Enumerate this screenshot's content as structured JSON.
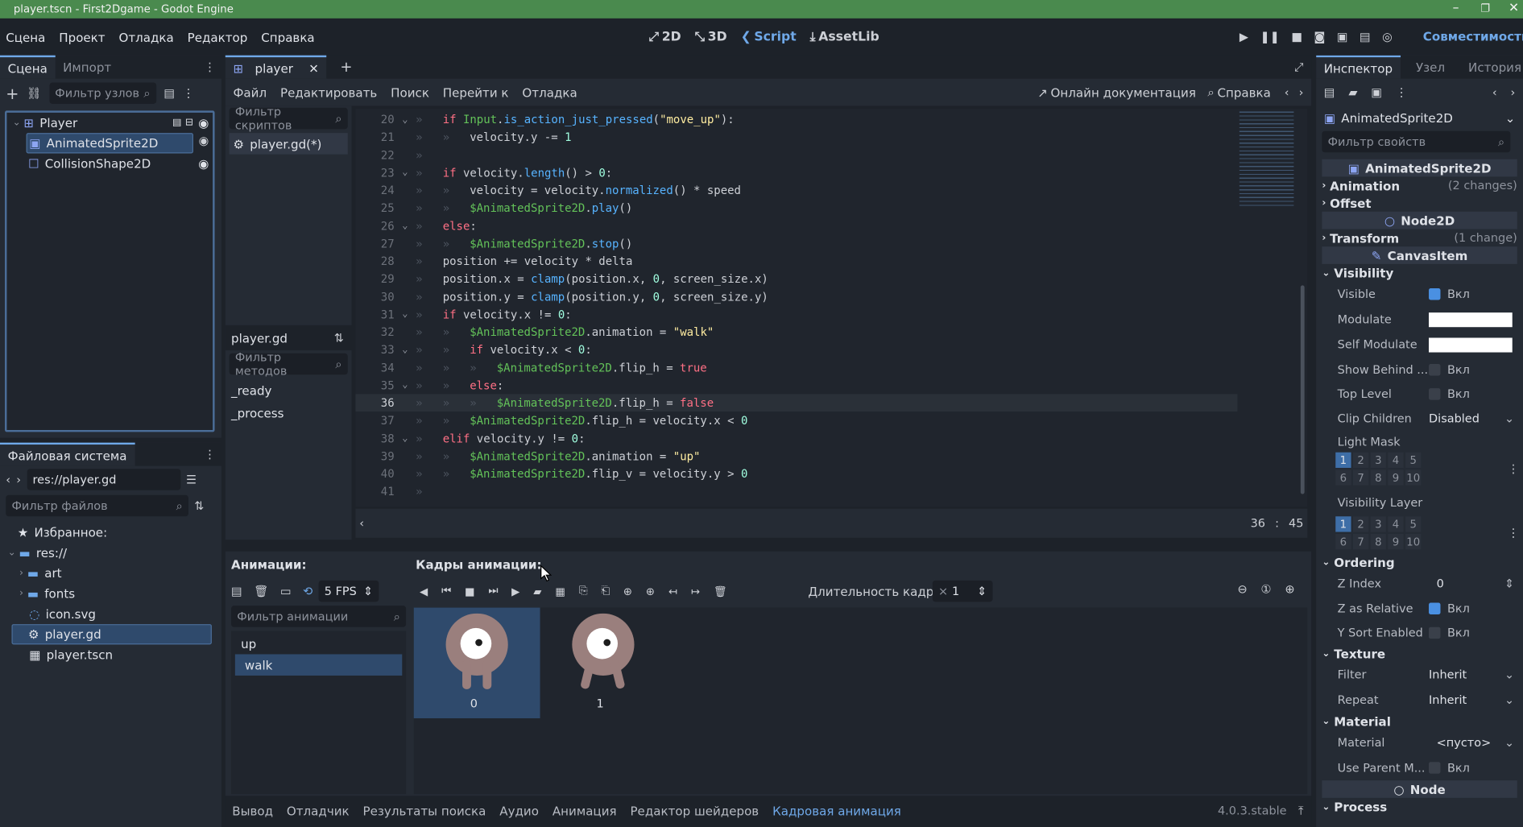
{
  "window": {
    "title": "player.tscn - First2Dgame - Godot Engine"
  },
  "menu": {
    "items": [
      "Сцена",
      "Проект",
      "Отладка",
      "Редактор",
      "Справка"
    ]
  },
  "workspaces": {
    "d2": "2D",
    "d3": "3D",
    "script": "Script",
    "assetlib": "AssetLib"
  },
  "renderer": "Совместимость",
  "scene_dock": {
    "tabs": [
      "Сцена",
      "Импорт"
    ],
    "filter_placeholder": "Фильтр узлов",
    "nodes": [
      "Player",
      "AnimatedSprite2D",
      "CollisionShape2D"
    ]
  },
  "fs_dock": {
    "title": "Файловая система",
    "path": "res://player.gd",
    "filter_placeholder": "Фильтр файлов",
    "favorites": "Избранное:",
    "root": "res://",
    "folders": [
      "art",
      "fonts"
    ],
    "files": [
      "icon.svg",
      "player.gd",
      "player.tscn"
    ]
  },
  "editor_tabs": {
    "current": "player"
  },
  "script_menu": {
    "items": [
      "Файл",
      "Редактировать",
      "Поиск",
      "Перейти к",
      "Отладка"
    ],
    "online_docs": "Онлайн документация",
    "help": "Справка"
  },
  "script_list": {
    "filter_placeholder": "Фильтр скриптов",
    "current": "player.gd(*)",
    "name": "player.gd",
    "methods_placeholder": "Фильтр методов",
    "methods": [
      "_ready",
      "_process"
    ]
  },
  "code": {
    "lines": [
      {
        "n": "20",
        "t": [
          [
            "kw",
            "if "
          ],
          [
            "nd",
            "Input"
          ],
          [
            "pl",
            "."
          ],
          [
            "fn",
            "is_action_just_pressed"
          ],
          [
            "pl",
            "("
          ],
          [
            "st",
            "\"move_up\""
          ],
          [
            "pl",
            "):"
          ]
        ],
        "ind": 1,
        "fold": true
      },
      {
        "n": "21",
        "t": [
          [
            "pl",
            "velocity.y "
          ],
          [
            "pl",
            "-= "
          ],
          [
            "nu",
            "1"
          ]
        ],
        "ind": 2
      },
      {
        "n": "22",
        "t": [],
        "ind": 1
      },
      {
        "n": "23",
        "t": [
          [
            "kw",
            "if "
          ],
          [
            "pl",
            "velocity."
          ],
          [
            "fn",
            "length"
          ],
          [
            "pl",
            "() > "
          ],
          [
            "nu",
            "0"
          ],
          [
            "pl",
            ":"
          ]
        ],
        "ind": 1,
        "fold": true
      },
      {
        "n": "24",
        "t": [
          [
            "pl",
            "velocity = velocity."
          ],
          [
            "fn",
            "normalized"
          ],
          [
            "pl",
            "() * speed"
          ]
        ],
        "ind": 2
      },
      {
        "n": "25",
        "t": [
          [
            "nd",
            "$AnimatedSprite2D"
          ],
          [
            "pl",
            "."
          ],
          [
            "fn",
            "play"
          ],
          [
            "pl",
            "()"
          ]
        ],
        "ind": 2
      },
      {
        "n": "26",
        "t": [
          [
            "kw",
            "else"
          ],
          [
            "pl",
            ":"
          ]
        ],
        "ind": 1,
        "fold": true
      },
      {
        "n": "27",
        "t": [
          [
            "nd",
            "$AnimatedSprite2D"
          ],
          [
            "pl",
            "."
          ],
          [
            "fn",
            "stop"
          ],
          [
            "pl",
            "()"
          ]
        ],
        "ind": 2
      },
      {
        "n": "28",
        "t": [
          [
            "pl",
            "position += velocity * delta"
          ]
        ],
        "ind": 1
      },
      {
        "n": "29",
        "t": [
          [
            "pl",
            "position.x = "
          ],
          [
            "fn",
            "clamp"
          ],
          [
            "pl",
            "(position.x, "
          ],
          [
            "nu",
            "0"
          ],
          [
            "pl",
            ", screen_size.x)"
          ]
        ],
        "ind": 1
      },
      {
        "n": "30",
        "t": [
          [
            "pl",
            "position.y = "
          ],
          [
            "fn",
            "clamp"
          ],
          [
            "pl",
            "(position.y, "
          ],
          [
            "nu",
            "0"
          ],
          [
            "pl",
            ", screen_size.y)"
          ]
        ],
        "ind": 1
      },
      {
        "n": "31",
        "t": [
          [
            "kw",
            "if "
          ],
          [
            "pl",
            "velocity.x != "
          ],
          [
            "nu",
            "0"
          ],
          [
            "pl",
            ":"
          ]
        ],
        "ind": 1,
        "fold": true
      },
      {
        "n": "32",
        "t": [
          [
            "nd",
            "$AnimatedSprite2D"
          ],
          [
            "pl",
            ".animation = "
          ],
          [
            "st",
            "\"walk\""
          ]
        ],
        "ind": 2
      },
      {
        "n": "33",
        "t": [
          [
            "kw",
            "if "
          ],
          [
            "pl",
            "velocity.x < "
          ],
          [
            "nu",
            "0"
          ],
          [
            "pl",
            ":"
          ]
        ],
        "ind": 2,
        "fold": true
      },
      {
        "n": "34",
        "t": [
          [
            "nd",
            "$AnimatedSprite2D"
          ],
          [
            "pl",
            ".flip_h = "
          ],
          [
            "bt",
            "true"
          ]
        ],
        "ind": 3
      },
      {
        "n": "35",
        "t": [
          [
            "kw",
            "else"
          ],
          [
            "pl",
            ":"
          ]
        ],
        "ind": 2,
        "fold": true
      },
      {
        "n": "36",
        "t": [
          [
            "nd",
            "$AnimatedSprite2D"
          ],
          [
            "pl",
            ".flip_h = "
          ],
          [
            "bt",
            "false"
          ]
        ],
        "ind": 3,
        "current": true
      },
      {
        "n": "37",
        "t": [
          [
            "nd",
            "$AnimatedSprite2D"
          ],
          [
            "pl",
            ".flip_h = velocity.x < "
          ],
          [
            "nu",
            "0"
          ]
        ],
        "ind": 2
      },
      {
        "n": "38",
        "t": [
          [
            "kw",
            "elif "
          ],
          [
            "pl",
            "velocity.y != "
          ],
          [
            "nu",
            "0"
          ],
          [
            "pl",
            ":"
          ]
        ],
        "ind": 1,
        "fold": true
      },
      {
        "n": "39",
        "t": [
          [
            "nd",
            "$AnimatedSprite2D"
          ],
          [
            "pl",
            ".animation = "
          ],
          [
            "st",
            "\"up\""
          ]
        ],
        "ind": 2
      },
      {
        "n": "40",
        "t": [
          [
            "nd",
            "$AnimatedSprite2D"
          ],
          [
            "pl",
            ".flip_v = velocity.y > "
          ],
          [
            "nu",
            "0"
          ]
        ],
        "ind": 2
      },
      {
        "n": "41",
        "t": [],
        "ind": 1
      }
    ],
    "cursor_line": "36",
    "cursor_col": "45",
    "sep": ":"
  },
  "anim_panel": {
    "animations_label": "Анимации:",
    "frames_label": "Кадры анимации:",
    "fps": "5 FPS",
    "filter_placeholder": "Фильтр анимации",
    "anims": [
      "up",
      "walk"
    ],
    "selected": "walk",
    "duration_label": "Длительность кадра:",
    "duration_value": "1",
    "frames": [
      "0",
      "1"
    ]
  },
  "bottom_tabs": [
    "Вывод",
    "Отладчик",
    "Результаты поиска",
    "Аудио",
    "Анимация",
    "Редактор шейдеров",
    "Кадровая анимация"
  ],
  "version": "4.0.3.stable",
  "inspector": {
    "tabs": [
      "Инспектор",
      "Узел",
      "История"
    ],
    "node": "AnimatedSprite2D",
    "filter_placeholder": "Фильтр свойств",
    "class1": "AnimatedSprite2D",
    "animation": "Animation",
    "animation_changes": "(2 changes)",
    "offset": "Offset",
    "class2": "Node2D",
    "transform": "Transform",
    "transform_changes": "(1 change)",
    "class3": "CanvasItem",
    "visibility": "Visibility",
    "visible": "Visible",
    "on": "Вкл",
    "modulate": "Modulate",
    "self_modulate": "Self Modulate",
    "show_behind": "Show Behind ...",
    "top_level": "Top Level",
    "clip_children": "Clip Children",
    "clip_value": "Disabled",
    "light_mask": "Light Mask",
    "visibility_layer": "Visibility Layer",
    "ordering": "Ordering",
    "z_index": "Z Index",
    "z_value": "0",
    "z_relative": "Z as Relative",
    "y_sort": "Y Sort Enabled",
    "texture": "Texture",
    "filter": "Filter",
    "filter_value": "Inherit",
    "repeat": "Repeat",
    "repeat_value": "Inherit",
    "material": "Material",
    "material_label": "Material",
    "material_value": "<пусто>",
    "use_parent": "Use Parent M...",
    "class4": "Node",
    "process": "Process",
    "layers": [
      "1",
      "2",
      "3",
      "4",
      "5",
      "6",
      "7",
      "8",
      "9",
      "10"
    ]
  },
  "colors": {
    "accent": "#6fa8e8",
    "titlebar": "#4a8a4e",
    "panel": "#252b34",
    "bg": "#1d2229"
  }
}
